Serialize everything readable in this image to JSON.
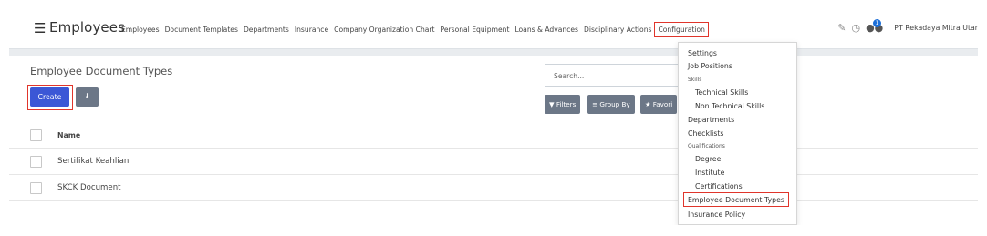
{
  "navbar": {
    "app_title": "Employees",
    "menu": [
      "Employees",
      "Document Templates",
      "Departments",
      "Insurance",
      "Company Organization Chart",
      "Personal Equipment",
      "Loans & Advances",
      "Disciplinary Actions",
      "Configuration"
    ],
    "chat_badge": "1",
    "company": "PT Rekadaya Mitra Utar"
  },
  "control": {
    "title": "Employee Document Types",
    "search_placeholder": "Search...",
    "create_label": "Create",
    "filters_label": "Filters",
    "group_by_label": "Group By",
    "favorites_label": "Favori"
  },
  "list": {
    "header": "Name",
    "rows": [
      "Sertifikat Keahlian",
      "SKCK Document"
    ]
  },
  "dropdown": {
    "settings": "Settings",
    "job_positions": "Job Positions",
    "skills_header": "Skills",
    "technical_skills": "Technical Skills",
    "non_technical_skills": "Non Technical Skills",
    "departments": "Departments",
    "checklists": "Checklists",
    "qualifications_header": "Qualifications",
    "degree": "Degree",
    "institute": "Institute",
    "certifications": "Certifications",
    "employee_document_types": "Employee Document Types",
    "insurance_policy": "Insurance Policy"
  },
  "colors": {
    "primary": "#3b57d6",
    "secondary": "#6c7787",
    "highlight": "#e0352b"
  }
}
